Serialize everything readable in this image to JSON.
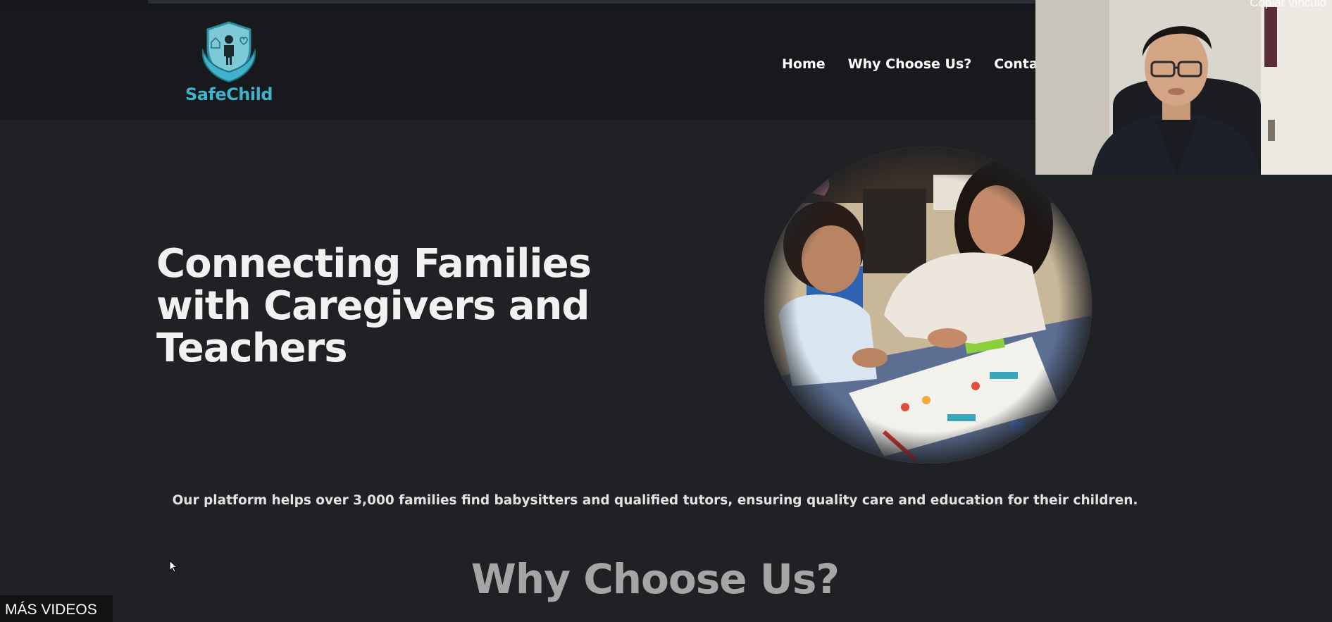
{
  "brand": {
    "name": "SafeChild",
    "logo_color": "#3fb3c9"
  },
  "nav": {
    "items": [
      {
        "label": "Home"
      },
      {
        "label": "Why Choose Us?"
      },
      {
        "label": "Contact"
      }
    ]
  },
  "hero": {
    "title_line1": "Connecting Families",
    "title_line2": "with Caregivers and",
    "title_line3": "Teachers",
    "subtitle": "Our platform helps over 3,000 families find babysitters and qualified tutors, ensuring quality care and education for their children.",
    "image_alt": "hero-photo-caregiver-and-child"
  },
  "section": {
    "title": "Why Choose Us?"
  },
  "overlay": {
    "copy_link": "Copiar vínculo",
    "more_videos": "MÁS VIDEOS"
  },
  "colors": {
    "page_bg": "#1f2124",
    "header_bg": "#18191c",
    "text": "#f1f1f1",
    "section_title": "#a5a5a5"
  }
}
